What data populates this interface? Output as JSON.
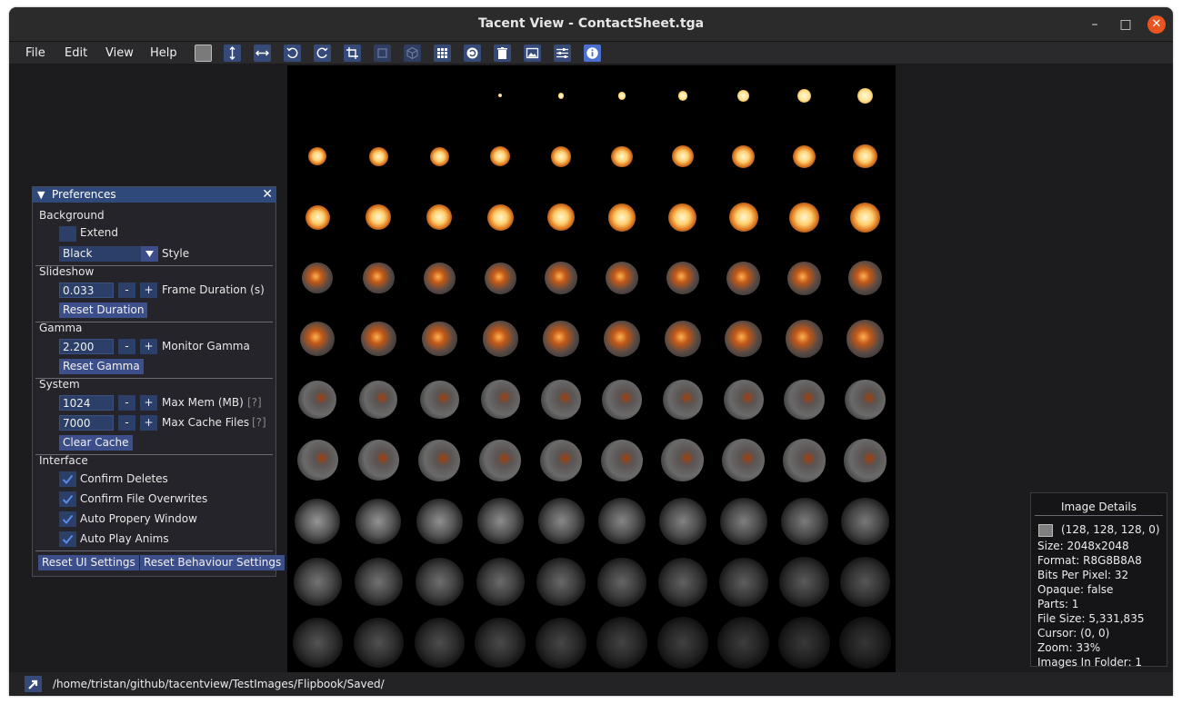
{
  "window": {
    "title": "Tacent View - ContactSheet.tga",
    "minimize": "–",
    "maximize": "□",
    "close": "✕"
  },
  "menus": [
    "File",
    "Edit",
    "View",
    "Help"
  ],
  "toolbar_icons": [
    "background-swatch-icon",
    "flip-vertical-icon",
    "flip-horizontal-icon",
    "rotate-ccw-icon",
    "rotate-cw-icon",
    "crop-icon",
    "layers-icon",
    "cube-icon",
    "contact-sheet-icon",
    "refresh-icon",
    "delete-icon",
    "image-icon",
    "settings-sliders-icon",
    "info-icon"
  ],
  "preferences": {
    "title": "Preferences",
    "collapse_icon": "▼",
    "close_icon": "✕",
    "background": {
      "header": "Background",
      "extend_label": "Extend",
      "style_value": "Black",
      "style_label": "Style"
    },
    "slideshow": {
      "header": "Slideshow",
      "duration": "0.033",
      "duration_label": "Frame Duration (s)",
      "reset": "Reset Duration"
    },
    "gamma": {
      "header": "Gamma",
      "value": "2.200",
      "label": "Monitor Gamma",
      "reset": "Reset Gamma"
    },
    "system": {
      "header": "System",
      "max_mem": "1024",
      "max_mem_label": "Max Mem (MB)",
      "max_cache": "7000",
      "max_cache_label": "Max Cache Files",
      "help": "[?]",
      "clear": "Clear Cache"
    },
    "interface": {
      "header": "Interface",
      "options": [
        {
          "label": "Confirm Deletes",
          "checked": true
        },
        {
          "label": "Confirm File Overwrites",
          "checked": true
        },
        {
          "label": "Auto Propery Window",
          "checked": true
        },
        {
          "label": "Auto Play Anims",
          "checked": true
        }
      ]
    },
    "minus": "-",
    "plus": "+",
    "reset_ui": "Reset UI Settings",
    "reset_behaviour": "Reset Behaviour Settings"
  },
  "details": {
    "header": "Image   Details",
    "color": "(128, 128, 128, 0)",
    "size": "Size: 2048x2048",
    "format": "Format: R8G8B8A8",
    "bpp": "Bits Per Pixel: 32",
    "opaque": "Opaque: false",
    "parts": "Parts: 1",
    "file_size": "File Size: 5,331,835",
    "cursor": "Cursor: (0, 0)",
    "zoom": "Zoom: 33%",
    "images_in_folder": "Images In Folder: 1"
  },
  "status": {
    "path": "/home/tristan/github/tacentview/TestImages/Flipbook/Saved/"
  },
  "colors": {
    "accent": "#364a7a",
    "panel_header": "#2f4a7a",
    "close_button": "#e95420",
    "check": "#5a8ae6"
  }
}
